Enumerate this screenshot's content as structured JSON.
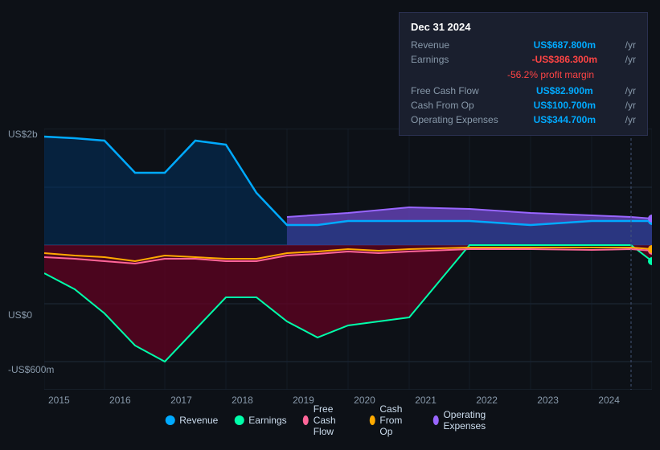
{
  "tooltip": {
    "date": "Dec 31 2024",
    "rows": [
      {
        "label": "Revenue",
        "value": "US$687.800m",
        "unit": "/yr",
        "color": "blue"
      },
      {
        "label": "Earnings",
        "value": "-US$386.300m",
        "unit": "/yr",
        "color": "red"
      },
      {
        "label": "",
        "value": "-56.2%",
        "unit": "profit margin",
        "color": "red"
      },
      {
        "label": "Free Cash Flow",
        "value": "US$82.900m",
        "unit": "/yr",
        "color": "blue"
      },
      {
        "label": "Cash From Op",
        "value": "US$100.700m",
        "unit": "/yr",
        "color": "blue"
      },
      {
        "label": "Operating Expenses",
        "value": "US$344.700m",
        "unit": "/yr",
        "color": "blue"
      }
    ]
  },
  "chart": {
    "y_top": "US$2b",
    "y_zero": "US$0",
    "y_neg": "-US$600m"
  },
  "x_labels": [
    "2015",
    "2016",
    "2017",
    "2018",
    "2019",
    "2020",
    "2021",
    "2022",
    "2023",
    "2024"
  ],
  "legend": [
    {
      "label": "Revenue",
      "color": "#00aaff"
    },
    {
      "label": "Earnings",
      "color": "#00ffaa"
    },
    {
      "label": "Free Cash Flow",
      "color": "#ff6699"
    },
    {
      "label": "Cash From Op",
      "color": "#ffaa00"
    },
    {
      "label": "Operating Expenses",
      "color": "#9966ff"
    }
  ]
}
